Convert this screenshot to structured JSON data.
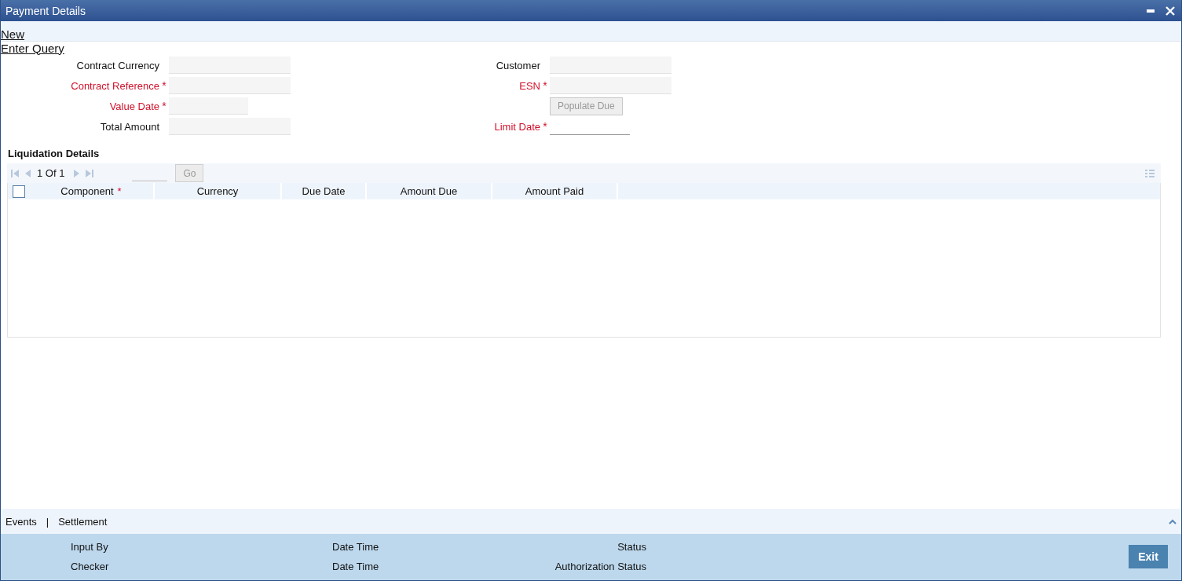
{
  "window": {
    "title": "Payment Details"
  },
  "menu": [
    {
      "label": "New"
    },
    {
      "label": "Enter Query"
    }
  ],
  "form": {
    "left": [
      {
        "kind": "text",
        "label": "Contract Currency",
        "required": false
      },
      {
        "kind": "text",
        "label": "Contract Reference",
        "required": true,
        "mark": "*"
      },
      {
        "kind": "date",
        "label": "Value Date",
        "required": true,
        "mark": "*"
      },
      {
        "kind": "text",
        "label": "Total Amount",
        "required": false
      }
    ],
    "right": [
      {
        "kind": "text",
        "label": "Customer",
        "required": false
      },
      {
        "kind": "text",
        "label": "ESN",
        "required": true,
        "mark": "*"
      },
      {
        "kind": "button",
        "label": "Populate Due",
        "disabled": true
      },
      {
        "kind": "line",
        "label": "Limit Date",
        "required": true,
        "mark": "*"
      }
    ]
  },
  "liquidation": {
    "title": "Liquidation Details",
    "pager": "1 Of 1",
    "go": {
      "label": "Go",
      "disabled": true
    },
    "select_all": {
      "checked": false
    },
    "columns": [
      {
        "label": "Component",
        "mark": "*"
      },
      {
        "label": "Currency"
      },
      {
        "label": "Due Date"
      },
      {
        "label": "Amount Due"
      },
      {
        "label": "Amount Paid"
      }
    ]
  },
  "bottom_tabs": {
    "items": [
      {
        "label": "Events"
      },
      {
        "label": "Settlement"
      }
    ],
    "separator": "|"
  },
  "audit": [
    [
      "Input By",
      "Date Time",
      "Status"
    ],
    [
      "Checker",
      "Date Time",
      "Authorization Status"
    ]
  ],
  "exit": {
    "label": "Exit"
  }
}
